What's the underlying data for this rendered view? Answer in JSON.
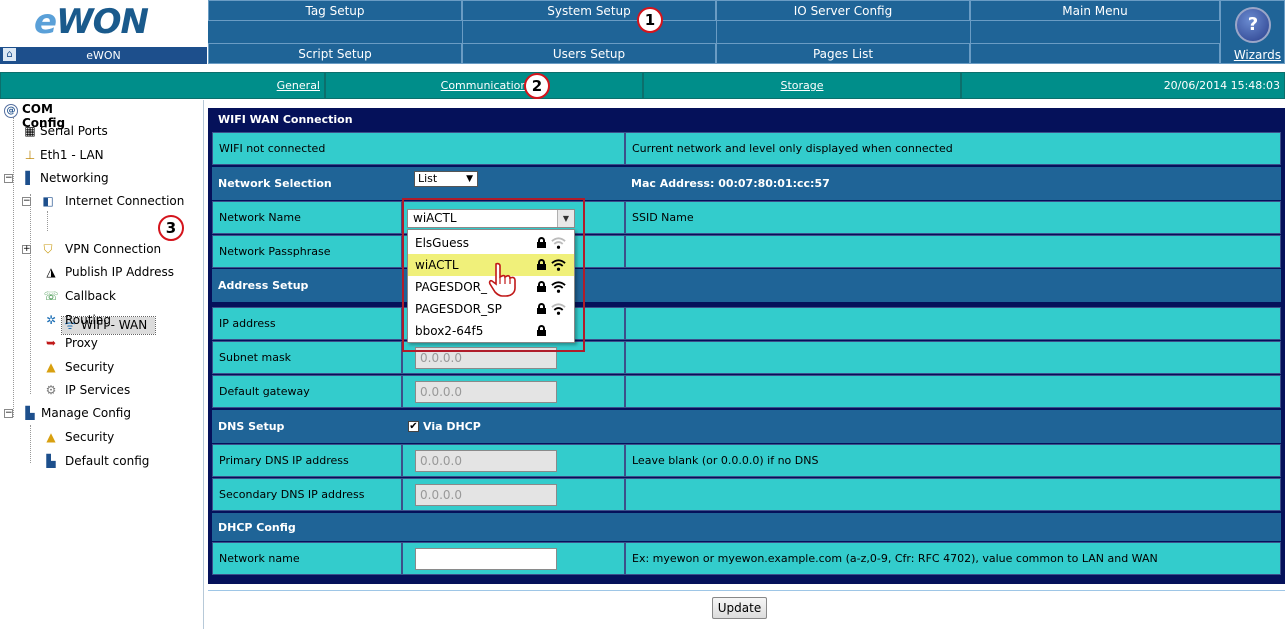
{
  "brand": {
    "logo": "eWON",
    "home_label": "eWON"
  },
  "menu": {
    "row1": [
      "Tag Setup",
      "System Setup",
      "IO Server Config",
      "Main Menu"
    ],
    "row2": [
      "Script Setup",
      "Users Setup",
      "Pages List",
      ""
    ],
    "wizards": "Wizards"
  },
  "subnav": {
    "items": [
      "General",
      "Communication",
      "Storage"
    ],
    "datetime": "20/06/2014 15:48:03"
  },
  "markers": [
    "1",
    "2",
    "3"
  ],
  "tree": {
    "root": "COM Config",
    "items": [
      "Serial Ports",
      "Eth1 - LAN",
      "Networking",
      "Internet Connection",
      "WIFI - WAN",
      "VPN Connection",
      "Publish IP Address",
      "Callback",
      "Routing",
      "Proxy",
      "Security",
      "IP Services",
      "Manage Config",
      "Security",
      "Default config"
    ]
  },
  "panel": {
    "title": "WIFI WAN Connection",
    "status_left": "WIFI not connected",
    "status_right": "Current network and level only displayed when connected",
    "network_selection": {
      "label": "Network Selection",
      "mode": "List",
      "mac": "Mac Address: 00:07:80:01:cc:57"
    },
    "network_name": {
      "label": "Network Name",
      "value": "wiACTL",
      "hint": "SSID Name"
    },
    "passphrase": {
      "label": "Network Passphrase"
    },
    "address_setup": {
      "label": "Address Setup"
    },
    "ip_address": {
      "label": "IP address"
    },
    "subnet_mask": {
      "label": "Subnet mask",
      "value": "0.0.0.0"
    },
    "default_gateway": {
      "label": "Default gateway",
      "value": "0.0.0.0"
    },
    "dns_setup": {
      "label": "DNS Setup",
      "via_dhcp": "Via DHCP"
    },
    "primary_dns": {
      "label": "Primary DNS IP address",
      "value": "0.0.0.0",
      "hint": "Leave blank (or 0.0.0.0) if no DNS"
    },
    "secondary_dns": {
      "label": "Secondary DNS IP address",
      "value": "0.0.0.0"
    },
    "dhcp_config": {
      "label": "DHCP Config"
    },
    "dhcp_network_name": {
      "label": "Network name",
      "value": "",
      "hint": "Ex: myewon or myewon.example.com (a-z,0-9, Cfr: RFC 4702), value common to LAN and WAN"
    }
  },
  "dropdown": {
    "options": [
      "ElsGuess",
      "wiACTL",
      "PAGESDOR_",
      "PAGESDOR_SP",
      "bbox2-64f5"
    ],
    "highlighted": "wiACTL",
    "highlight_color": "#f0f07a"
  },
  "update_button": "Update",
  "colors": {
    "menu_blue": "#1f6497",
    "teal": "#008e8a",
    "cell_cyan": "#33cccc",
    "panel_navy": "#05115a",
    "marker_red": "#d4141c"
  }
}
